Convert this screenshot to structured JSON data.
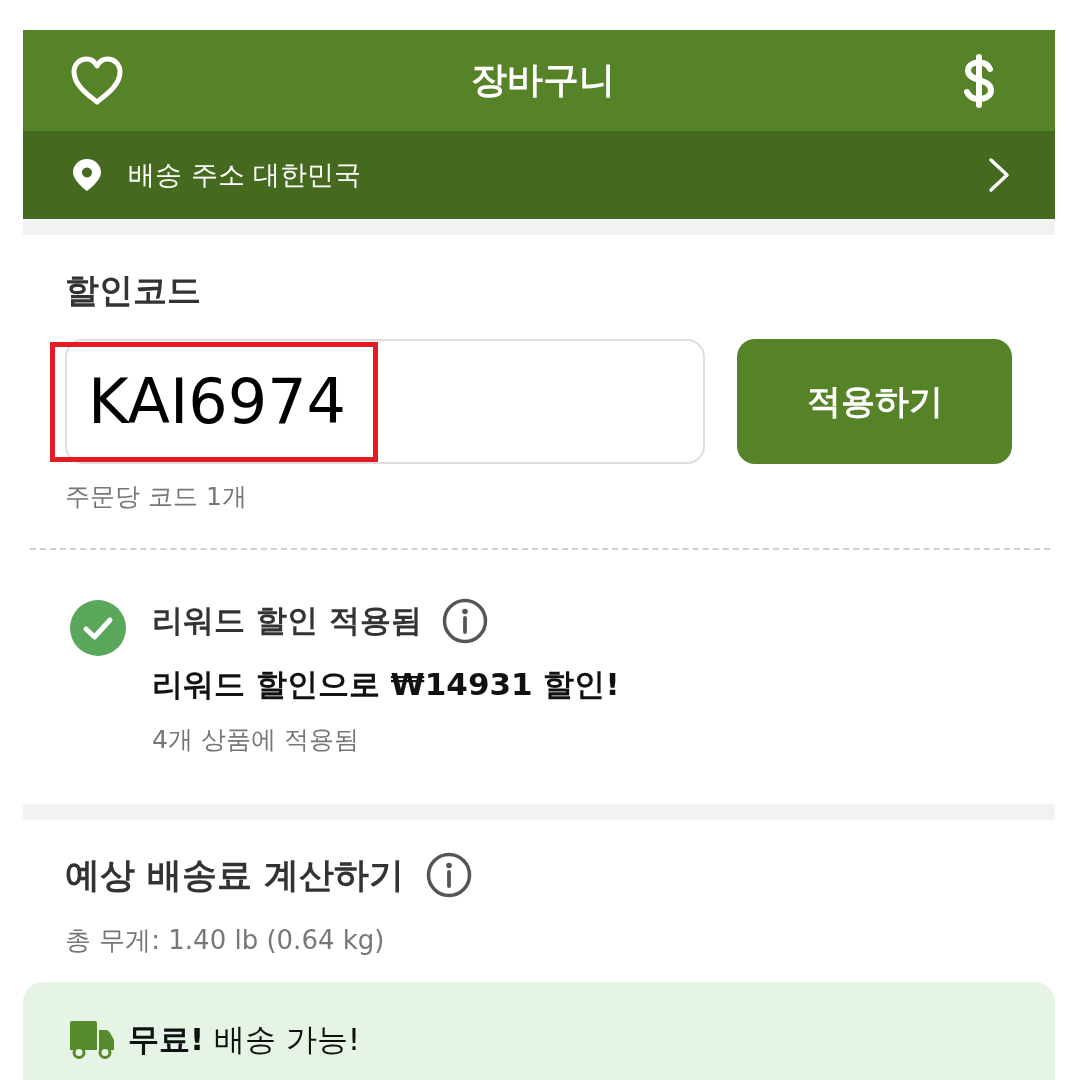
{
  "header": {
    "title": "장바구니"
  },
  "address_bar": {
    "label": "배송 주소 대한민국"
  },
  "discount_code": {
    "title": "할인코드",
    "input": {
      "value": "KAI6974",
      "highlighted": true
    },
    "apply_button": "적용하기",
    "note": "주문당 코드 1개"
  },
  "reward": {
    "title": "리워드 할인 적용됨",
    "applied": true,
    "message": "리워드 할인으로 **₩14931** 할인!",
    "detail": "4개 상품에 적용됨"
  },
  "shipping": {
    "title": "예상 배송료 계산하기",
    "weight": "총 무게: 1.40 lb (0.64 kg)",
    "banner": "**무료!** 배송 가능!"
  }
}
